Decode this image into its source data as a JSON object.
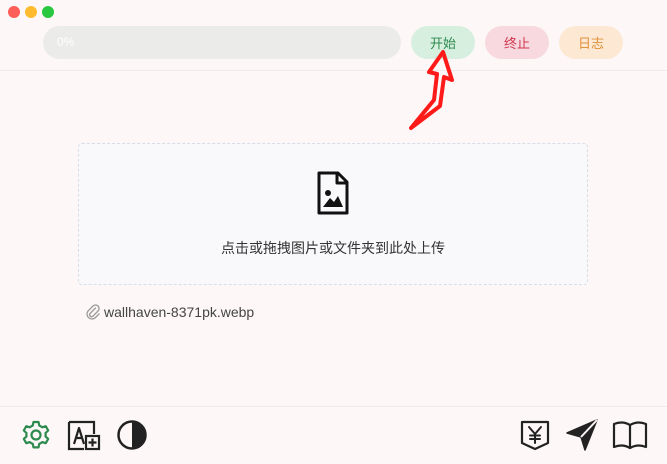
{
  "progress": {
    "label": "0%",
    "value": 0
  },
  "toolbar": {
    "start_label": "开始",
    "stop_label": "终止",
    "log_label": "日志"
  },
  "dropzone": {
    "text": "点击或拖拽图片或文件夹到此处上传",
    "icon": "file-image-icon"
  },
  "file": {
    "name": "wallhaven-8371pk.webp",
    "icon": "paperclip-icon"
  },
  "bottom_left_icons": [
    "gear-icon",
    "font-add-icon",
    "contrast-icon"
  ],
  "bottom_right_icons": [
    "yen-download-icon",
    "paper-plane-icon",
    "book-open-icon"
  ],
  "colors": {
    "accent_green": "#2d8a4e",
    "start_bg": "#d6efdf",
    "stop_bg": "#f8d9e0",
    "stop_text": "#d0364e",
    "log_bg": "#fde8d3",
    "log_text": "#e0913a",
    "annotation_arrow": "#ff1a1a"
  }
}
